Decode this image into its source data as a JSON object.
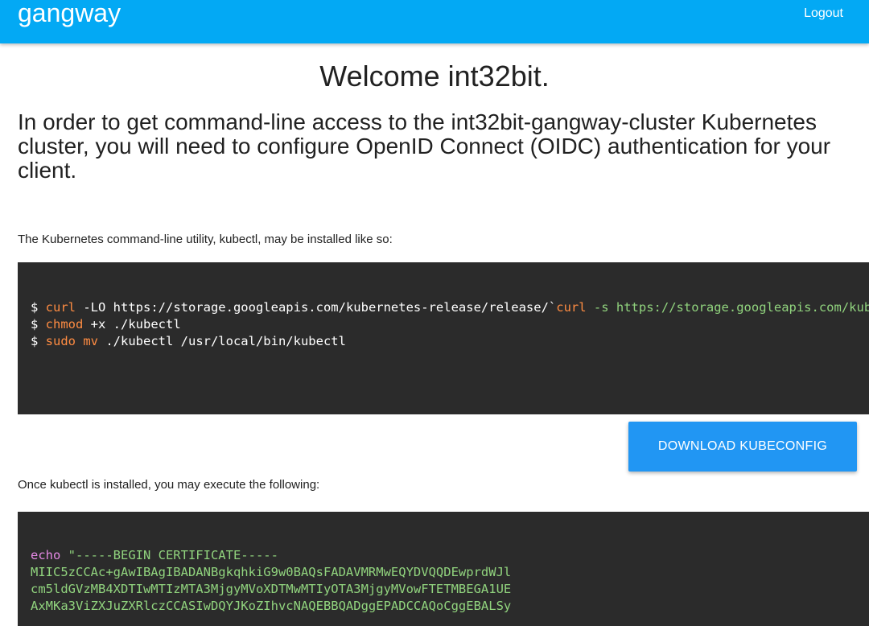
{
  "header": {
    "brand": "gangway",
    "logout_label": "Logout"
  },
  "main": {
    "welcome": "Welcome int32bit.",
    "intro": "In order to get command-line access to the int32bit-gangway-cluster Kubernetes cluster, you will need to configure OpenID Connect (OIDC) authentication for your client.",
    "install_label": "The Kubernetes command-line utility, kubectl, may be installed like so:",
    "install_code": {
      "line1": {
        "prompt": "$ ",
        "cmd": "curl",
        "args": " -LO https://storage.googleapis.com/kubernetes-release/release/`",
        "cmd2": "curl",
        "str": " -s https://storage.googleapis.com/kubernetes-release/release/stable.txt"
      },
      "line2": {
        "prompt": "$ ",
        "cmd": "chmod",
        "args": " +x ./kubectl"
      },
      "line3": {
        "prompt": "$ ",
        "cmd": "sudo mv",
        "args": " ./kubectl /usr/local/bin/kubectl"
      }
    },
    "download_label": "DOWNLOAD KUBECONFIG",
    "execute_label": "Once kubectl is installed, you may execute the following:",
    "exec_code": {
      "echo_kw": "echo",
      "begin": " \"-----BEGIN CERTIFICATE-----",
      "cert_lines": [
        "MIIC5zCCAc+gAwIBAgIBADANBgkqhkiG9w0BAQsFADAVMRMwEQYDVQQDEwprdWJl",
        "cm5ldGVzMB4XDTIwMTIzMTA3MjgyMVoXDTMwMTIyOTA3MjgyMVowFTETMBEGA1UE",
        "AxMKa3ViZXJuZXRlczCCASIwDQYJKoZIhvcNAQEBBQADggEPADCCAQoCggEBALSy"
      ]
    }
  },
  "colors": {
    "header_bg": "#03a9f4",
    "button_bg": "#2196f3",
    "code_bg": "#2b2b2b",
    "code_cmd": "#ff8c42",
    "code_string": "#91d47e",
    "code_keyword": "#e489e4"
  }
}
